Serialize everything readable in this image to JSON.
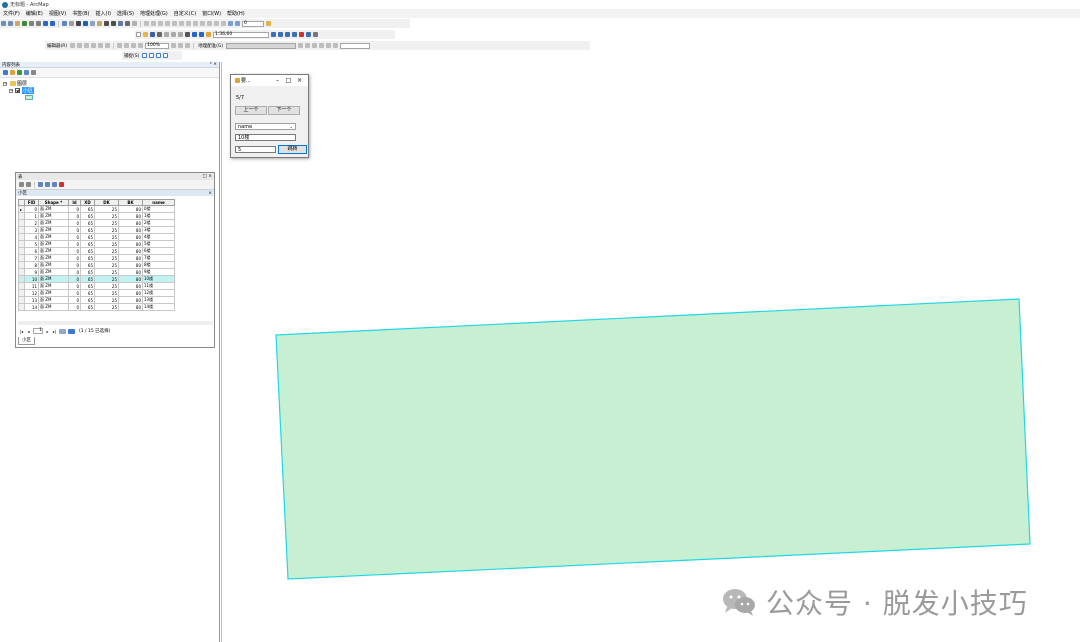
{
  "window": {
    "title": "无标题 - ArcMap"
  },
  "menu": [
    "文件(F)",
    "编辑(E)",
    "视图(V)",
    "书签(B)",
    "插入(I)",
    "选择(S)",
    "地理处理(G)",
    "自定义(C)",
    "窗口(W)",
    "帮助(H)"
  ],
  "toolbar": {
    "scale_value": "1:36,60",
    "zoom_value": "0",
    "editor_label": "编辑器(R)",
    "georef_label": "地理配准(G)",
    "snapping_label": "捕捉(S)",
    "percent_value": "100%"
  },
  "toc": {
    "title": "内容列表",
    "root_label": "图层",
    "layer_label": "小区"
  },
  "attr_table": {
    "window_title": "表",
    "table_name": "小区",
    "columns": [
      "FID",
      "Shape *",
      "Id",
      "XD",
      "DK",
      "BK",
      "name"
    ],
    "rows": [
      [
        "0",
        "面 ZM",
        "0",
        "65",
        "25",
        "80",
        "0楼"
      ],
      [
        "1",
        "面 ZM",
        "0",
        "65",
        "25",
        "80",
        "1楼"
      ],
      [
        "2",
        "面 ZM",
        "0",
        "65",
        "25",
        "80",
        "2楼"
      ],
      [
        "3",
        "面 ZM",
        "0",
        "65",
        "25",
        "80",
        "3楼"
      ],
      [
        "4",
        "面 ZM",
        "0",
        "65",
        "25",
        "80",
        "4楼"
      ],
      [
        "5",
        "面 ZM",
        "0",
        "65",
        "25",
        "80",
        "5楼"
      ],
      [
        "6",
        "面 ZM",
        "0",
        "65",
        "25",
        "80",
        "6楼"
      ],
      [
        "7",
        "面 ZM",
        "0",
        "65",
        "25",
        "80",
        "7楼"
      ],
      [
        "8",
        "面 ZM",
        "0",
        "65",
        "25",
        "80",
        "8楼"
      ],
      [
        "9",
        "面 ZM",
        "0",
        "65",
        "25",
        "80",
        "9楼"
      ],
      [
        "10",
        "面 ZM",
        "0",
        "65",
        "25",
        "80",
        "10楼"
      ],
      [
        "11",
        "面 ZM",
        "0",
        "65",
        "25",
        "80",
        "11楼"
      ],
      [
        "12",
        "面 ZM",
        "0",
        "65",
        "25",
        "80",
        "12楼"
      ],
      [
        "13",
        "面 ZM",
        "0",
        "65",
        "25",
        "80",
        "13楼"
      ],
      [
        "14",
        "面 ZM",
        "0",
        "65",
        "25",
        "80",
        "14楼"
      ]
    ],
    "highlight_row": 10,
    "current_record": "1",
    "selection_status": "(1 / 15 已选择)"
  },
  "dialog": {
    "title": "要...",
    "counter": "5/7",
    "prev_label": "上一个",
    "next_label": "下一个",
    "field_select": "name",
    "value_field": "10楼",
    "jump_input": "5",
    "jump_label": "跳转"
  },
  "watermark": {
    "text": "公众号 · 脱发小技巧"
  },
  "colors": {
    "polygon_fill": "#c6f0d1",
    "polygon_stroke": "#22d6e6",
    "highlight": "#bff2f0",
    "selected_layer": "#3399ff"
  }
}
